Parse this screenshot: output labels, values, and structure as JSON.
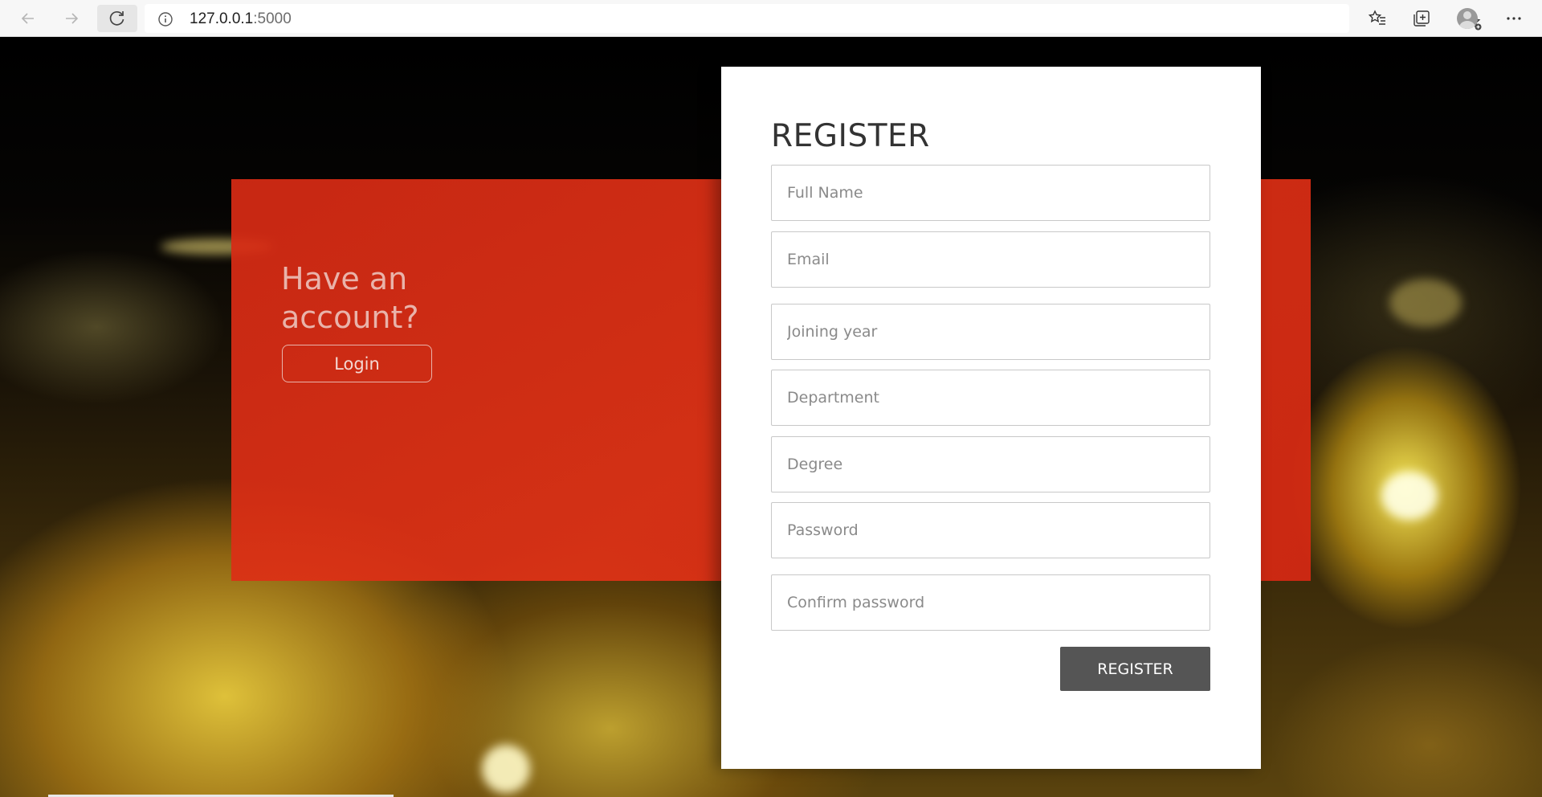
{
  "browser": {
    "url_host": "127.0.0.1",
    "url_port": ":5000"
  },
  "auth_panel": {
    "prompt": "Have an account?",
    "login_label": "Login"
  },
  "register_form": {
    "title": "REGISTER",
    "fields": {
      "full_name": "Full Name",
      "email": "Email",
      "joining_year": "Joining year",
      "department": "Department",
      "degree": "Degree",
      "password": "Password",
      "confirm_password": "Confirm password"
    },
    "submit_label": "REGISTER"
  },
  "colors": {
    "accent_red": "#d62a14",
    "button_gray": "#555555"
  }
}
